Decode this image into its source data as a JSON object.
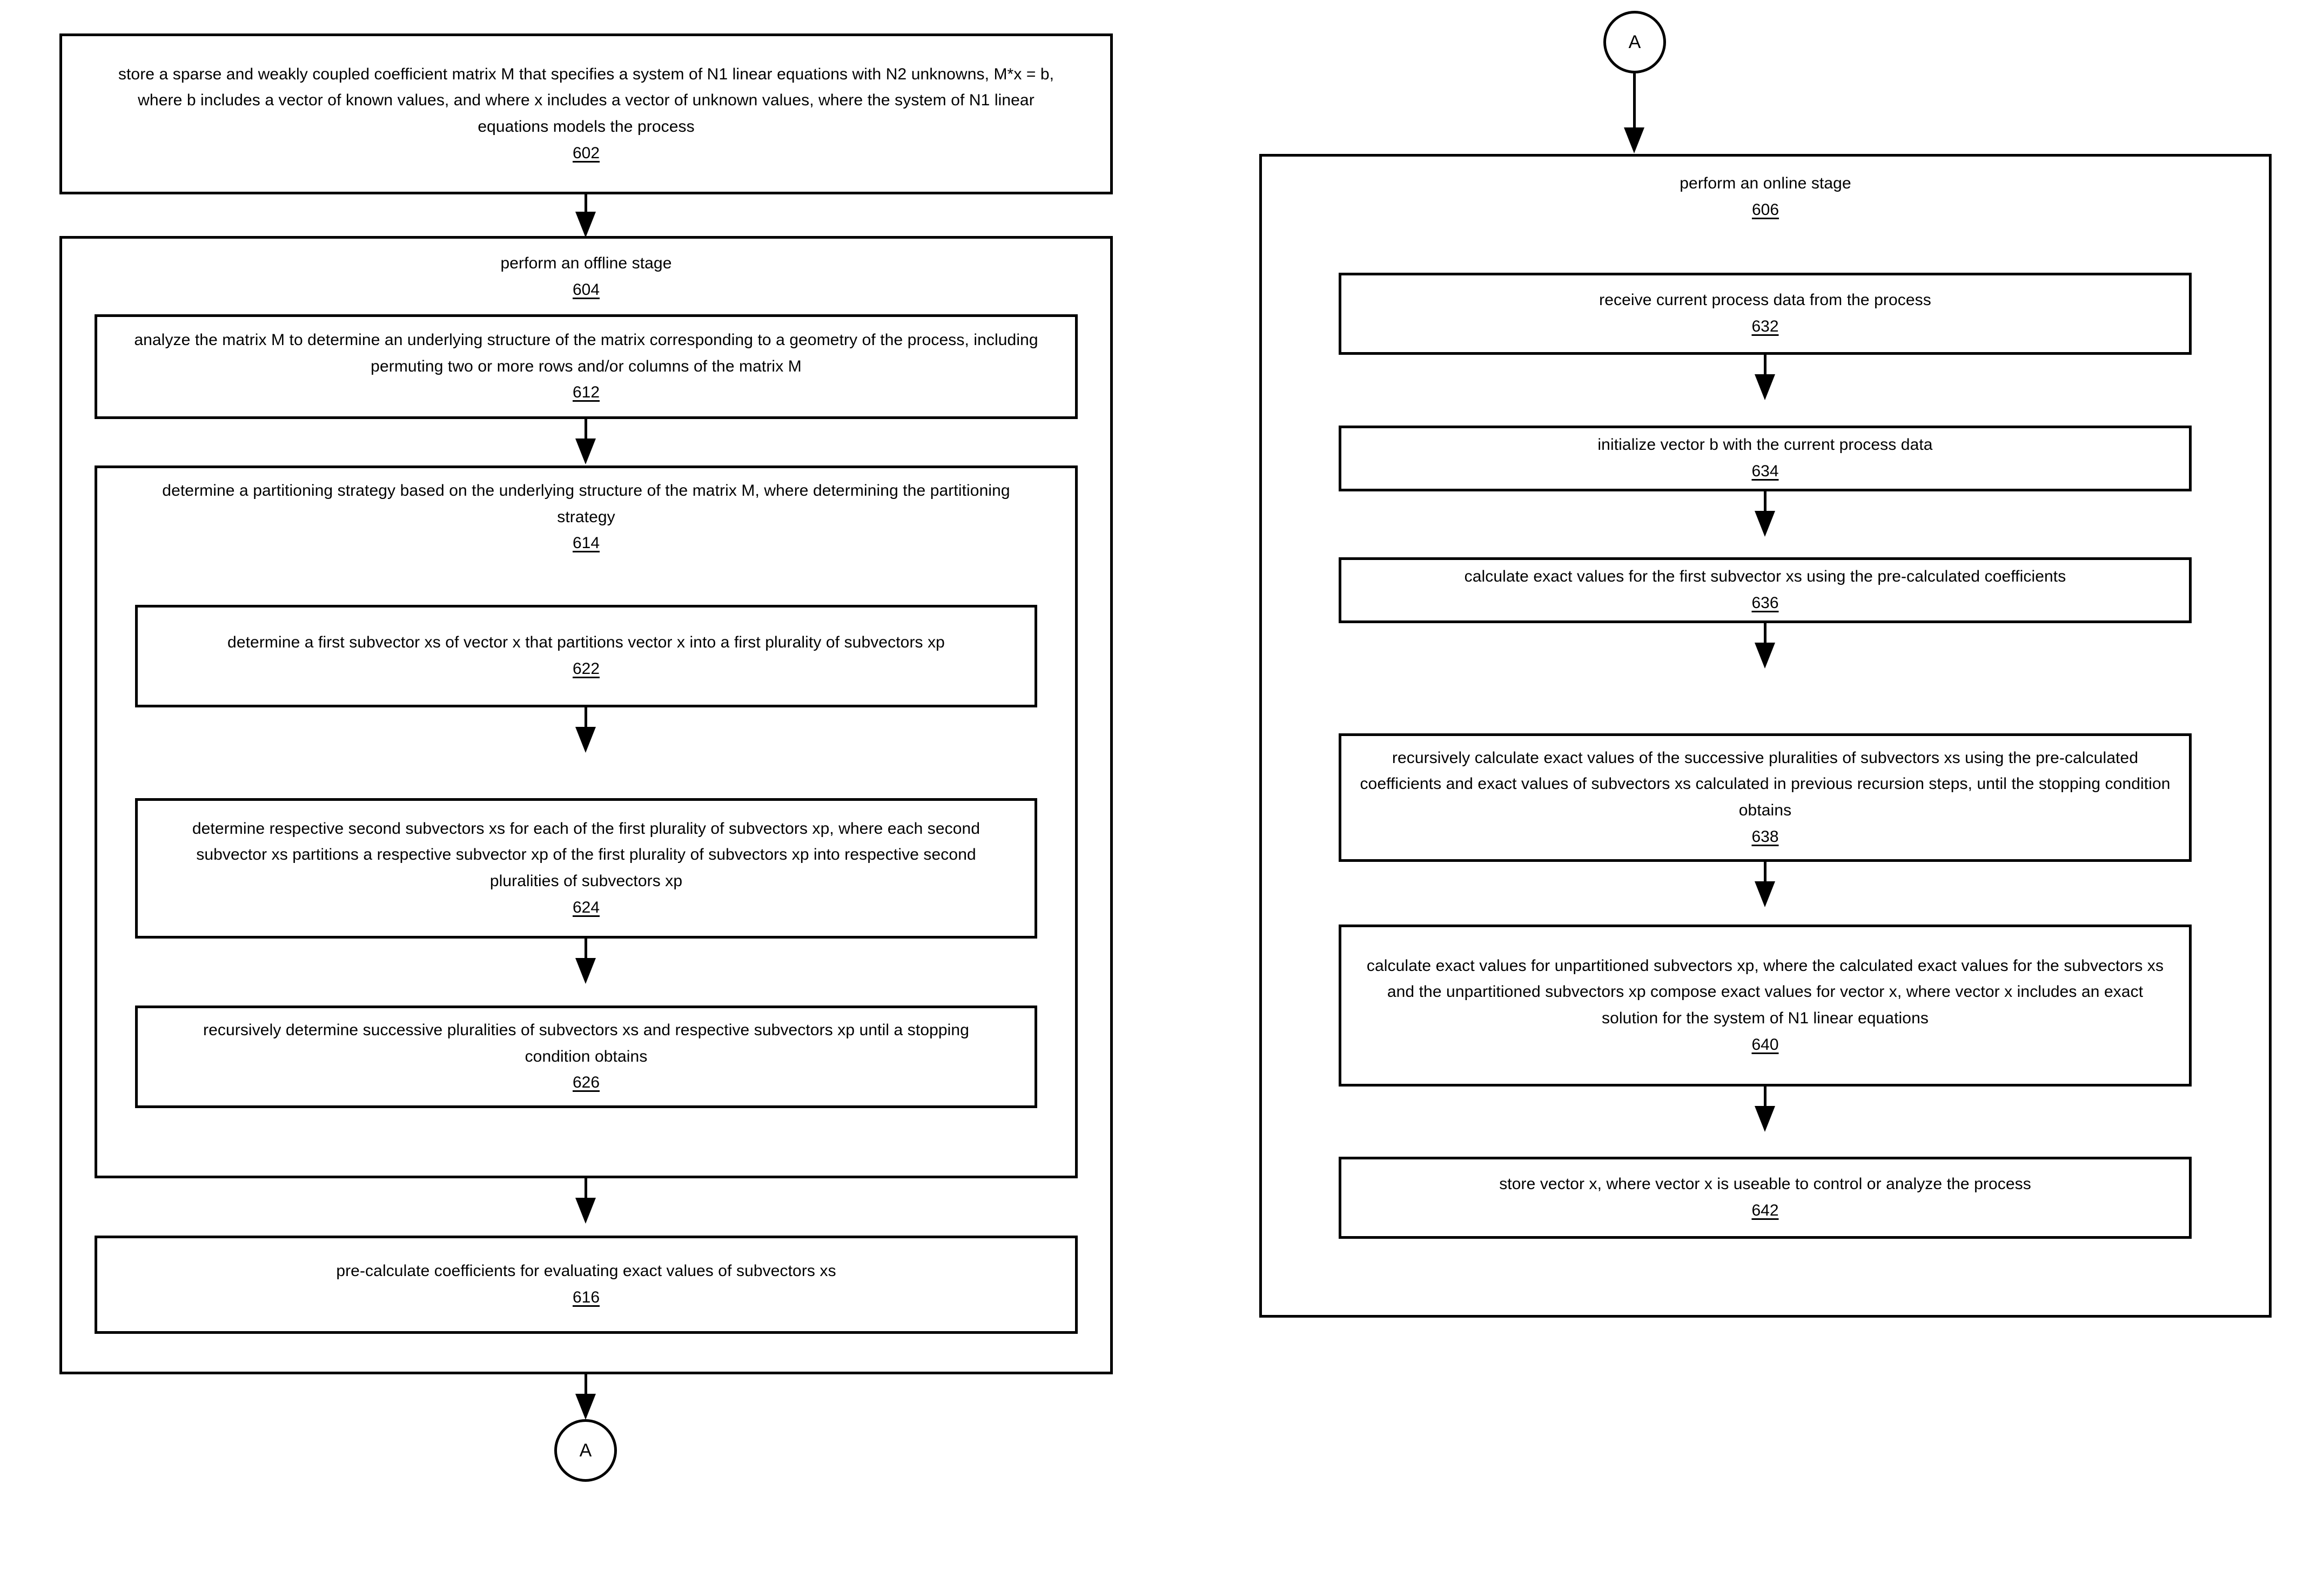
{
  "figure": {
    "type": "patent-flowchart",
    "connector_label": "A"
  },
  "left_column": {
    "step_602": {
      "text": "store a sparse and weakly coupled coefficient matrix M that specifies a system of N1 linear equations with N2 unknowns, M*x = b, where b includes a vector of known values, and where x includes a vector of unknown values, where the system of N1 linear equations models the process",
      "number": "602"
    },
    "step_604": {
      "text": "perform an offline stage",
      "number": "604"
    },
    "step_612": {
      "text": "analyze the matrix M to determine an underlying structure of the matrix corresponding to a geometry of the process, including permuting two or more rows and/or columns of the matrix M",
      "number": "612"
    },
    "step_614": {
      "text": "determine a partitioning strategy based on the underlying structure of the matrix M, where determining the partitioning strategy",
      "number": "614"
    },
    "step_622": {
      "text": "determine a first subvector xs of vector x that partitions vector x into a first plurality of subvectors xp",
      "number": "622"
    },
    "step_624": {
      "text": "determine respective second subvectors xs for each of the first plurality of subvectors xp, where each second subvector xs partitions a respective subvector xp of the first plurality of subvectors xp into respective second pluralities of subvectors xp",
      "number": "624"
    },
    "step_626": {
      "text": "recursively determine successive pluralities of subvectors xs and respective subvectors xp until a stopping condition obtains",
      "number": "626"
    },
    "step_616": {
      "text": "pre-calculate coefficients for evaluating exact values of subvectors xs",
      "number": "616"
    },
    "connector_out": "A"
  },
  "right_column": {
    "connector_in": "A",
    "step_606": {
      "text": "perform an online stage",
      "number": "606"
    },
    "step_632": {
      "text": "receive current process data from the process",
      "number": "632"
    },
    "step_634": {
      "text": "initialize vector b with the current process data",
      "number": "634"
    },
    "step_636": {
      "text": "calculate exact values for the first subvector xs using the pre-calculated coefficients",
      "number": "636"
    },
    "step_638": {
      "text": "recursively calculate exact values of the successive pluralities of subvectors xs using the pre-calculated coefficients and exact values of subvectors xs calculated in previous recursion steps, until the stopping condition obtains",
      "number": "638"
    },
    "step_640": {
      "text": "calculate exact values for unpartitioned subvectors xp, where the calculated exact values for the subvectors xs and the unpartitioned subvectors xp compose exact values for vector x, where vector x includes an exact solution for the system of N1 linear equations",
      "number": "640"
    },
    "step_642": {
      "text": "store vector x, where vector x is useable to control or analyze the process",
      "number": "642"
    }
  },
  "colors": {
    "stroke": "#000000",
    "background": "#ffffff"
  }
}
